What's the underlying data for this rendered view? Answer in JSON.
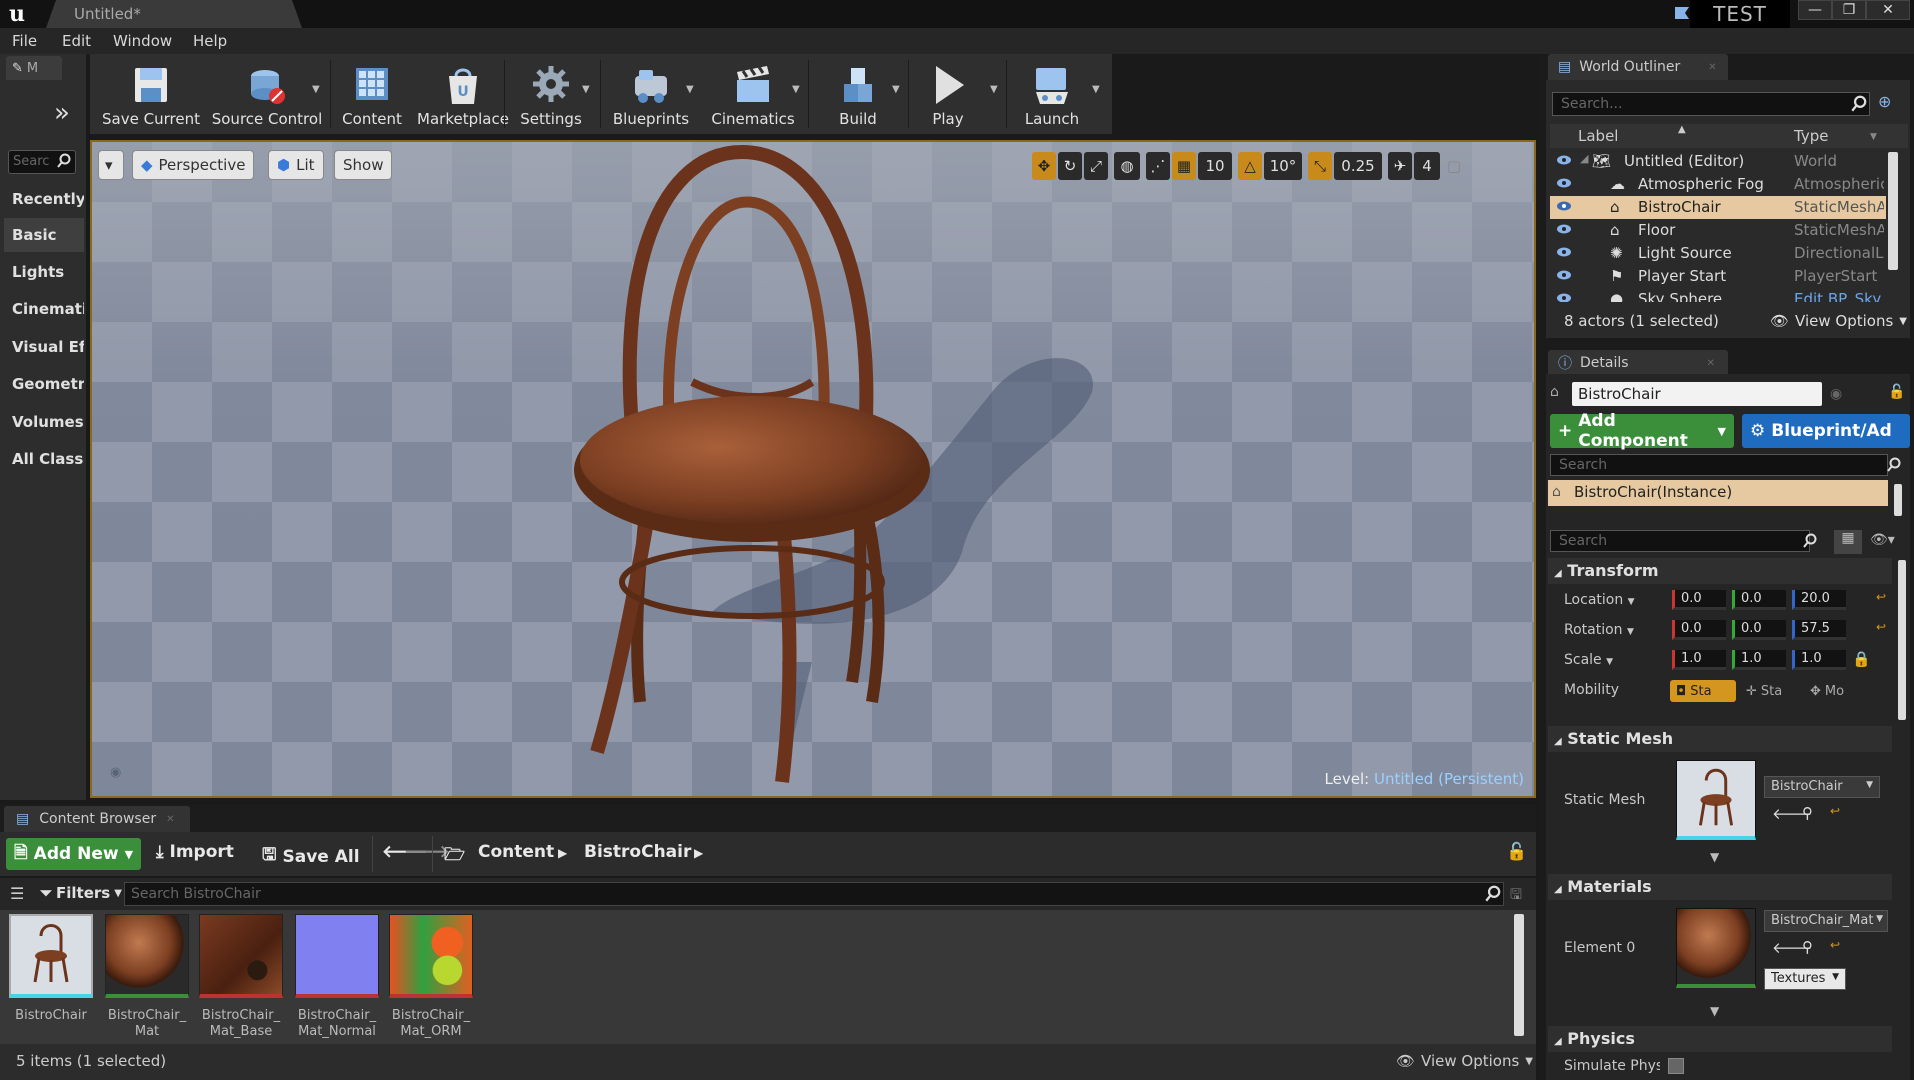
{
  "app": {
    "doc_tab": "Untitled*",
    "project": "TEST"
  },
  "window": {
    "minimize": "—",
    "maximize": "❐",
    "close": "✕"
  },
  "menu": [
    "File",
    "Edit",
    "Window",
    "Help"
  ],
  "modes": {
    "tab_label": "M",
    "search_placeholder": "Searc",
    "items": [
      "Recently",
      "Basic",
      "Lights",
      "Cinematic",
      "Visual Eff",
      "Geometry",
      "Volumes",
      "All Classe"
    ],
    "active": "Basic"
  },
  "toolbar": {
    "save_current": "Save Current",
    "source_control": "Source Control",
    "content": "Content",
    "marketplace": "Marketplace",
    "settings": "Settings",
    "blueprints": "Blueprints",
    "cinematics": "Cinematics",
    "build": "Build",
    "play": "Play",
    "launch": "Launch"
  },
  "viewport": {
    "perspective": "Perspective",
    "lit": "Lit",
    "show": "Show",
    "grid_snap": "10",
    "rot_snap": "10°",
    "scale_snap": "0.25",
    "cam_speed": "4",
    "level_label": "Level:",
    "level_value": "Untitled (Persistent)"
  },
  "content_browser": {
    "tab": "Content Browser",
    "add_new": "Add New",
    "import": "Import",
    "save_all": "Save All",
    "path": [
      "Content",
      "BistroChair"
    ],
    "filters": "Filters",
    "search_placeholder": "Search BistroChair",
    "assets": [
      {
        "name": "BistroChair",
        "selected": true
      },
      {
        "name": "BistroChair_ Mat",
        "selected": false
      },
      {
        "name": "BistroChair_ Mat_Base Color",
        "selected": false
      },
      {
        "name": "BistroChair_ Mat_Normal",
        "selected": false
      },
      {
        "name": "BistroChair_ Mat_ORM",
        "selected": false
      }
    ],
    "status": "5 items (1 selected)",
    "view_options": "View Options"
  },
  "outliner": {
    "tab": "World Outliner",
    "search_placeholder": "Search...",
    "col_label": "Label",
    "col_type": "Type",
    "rows": [
      {
        "label": "Untitled (Editor)",
        "type": "World",
        "indent": 0
      },
      {
        "label": "Atmospheric Fog",
        "type": "Atmospheric",
        "indent": 1
      },
      {
        "label": "BistroChair",
        "type": "StaticMeshA",
        "indent": 1,
        "selected": true
      },
      {
        "label": "Floor",
        "type": "StaticMeshA",
        "indent": 1
      },
      {
        "label": "Light Source",
        "type": "DirectionalLi",
        "indent": 1
      },
      {
        "label": "Player Start",
        "type": "PlayerStart",
        "indent": 1
      },
      {
        "label": "Sky Sphere",
        "type": "Edit BP_Sky",
        "indent": 1
      }
    ],
    "status": "8 actors (1 selected)",
    "view_options": "View Options"
  },
  "details": {
    "tab": "Details",
    "actor_name": "BistroChair",
    "add_component": "Add Component",
    "blueprint": "Blueprint/Ad",
    "search_placeholder": "Search",
    "component": "BistroChair(Instance)",
    "search2_placeholder": "Search",
    "transform": {
      "header": "Transform",
      "location_label": "Location",
      "location": [
        "0.0",
        "0.0",
        "20.0"
      ],
      "rotation_label": "Rotation",
      "rotation": [
        "0.0",
        "0.0",
        "57.5"
      ],
      "scale_label": "Scale",
      "scale": [
        "1.0",
        "1.0",
        "1.0"
      ],
      "mobility_label": "Mobility",
      "mobility": [
        "Sta",
        "Sta",
        "Mo"
      ]
    },
    "static_mesh": {
      "header": "Static Mesh",
      "label": "Static Mesh",
      "value": "BistroChair"
    },
    "materials": {
      "header": "Materials",
      "label": "Element 0",
      "value": "BistroChair_Mat",
      "textures": "Textures"
    },
    "physics": {
      "header": "Physics",
      "simulate": "Simulate Physi"
    }
  },
  "colors": {
    "accent": "#d5961f",
    "selection": "#e6c9a0",
    "green": "#3b8f3b",
    "blue": "#1e6bbf"
  }
}
